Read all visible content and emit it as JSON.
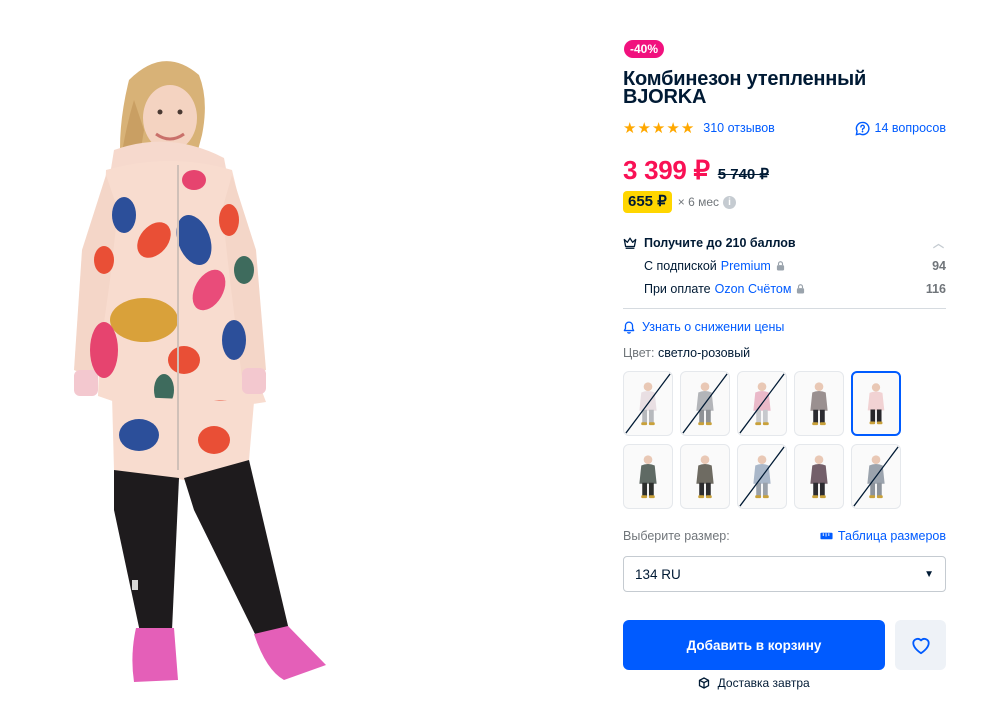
{
  "product": {
    "discount": "-40%",
    "title": "Комбинезон утепленный BJORKA",
    "rating_stars": 5,
    "reviews": "310 отзывов",
    "questions": "14 вопросов",
    "price": "3 399 ₽",
    "old_price": "5 740 ₽",
    "installment_price": "655 ₽",
    "installment_term": "× 6 мес",
    "info_icon": "i"
  },
  "points": {
    "heading": "Получите до 210 баллов",
    "subscription_prefix": "С подпиской",
    "subscription_name": "Premium",
    "subscription_value": "94",
    "payment_prefix": "При оплате",
    "payment_name": "Ozon Счётом",
    "payment_value": "116"
  },
  "notify_label": "Узнать о снижении цены",
  "color": {
    "label": "Цвет:",
    "value": "светло-розовый"
  },
  "swatches": [
    {
      "color": "#e9dfe3",
      "legs": "#b7b9bd",
      "available": false
    },
    {
      "color": "#b3b5b9",
      "legs": "#8f9296",
      "available": false
    },
    {
      "color": "#eab9c9",
      "legs": "#c7c9cd",
      "available": false
    },
    {
      "color": "#9a9090",
      "legs": "#2b2b30",
      "available": true
    },
    {
      "color": "#f1d2d3",
      "legs": "#27272b",
      "available": true,
      "selected": true
    },
    {
      "color": "#5f6a64",
      "legs": "#2c2f2d",
      "available": true
    },
    {
      "color": "#6e6b62",
      "legs": "#2d2d2f",
      "available": true
    },
    {
      "color": "#a9b7c9",
      "legs": "#9aa1aa",
      "available": false
    },
    {
      "color": "#735f6a",
      "legs": "#2b2b30",
      "available": true
    },
    {
      "color": "#9ba3ad",
      "legs": "#8d939b",
      "available": false
    }
  ],
  "size": {
    "label": "Выберите размер:",
    "table_link": "Таблица размеров",
    "selected": "134 RU"
  },
  "actions": {
    "add_to_cart": "Добавить в корзину",
    "delivery": "Доставка завтра"
  },
  "colors": {
    "accent": "#005bff",
    "price": "#f91155",
    "badge": "#f1117e",
    "star": "#ffa800",
    "installment": "#ffd600"
  }
}
